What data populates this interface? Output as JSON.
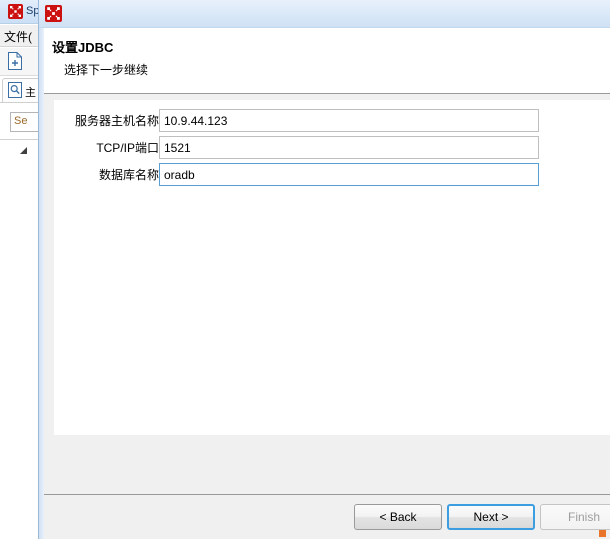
{
  "background_app": {
    "title": "Sp",
    "icon": "app-red-network-icon",
    "menu": {
      "file_label": "文件("
    },
    "toolbar": {
      "new_document_icon": "new-document-icon"
    },
    "tab": {
      "icon": "document-search-icon",
      "label": "主"
    },
    "search": {
      "value": "Se"
    },
    "tree": {
      "collapse_arrow_icon": "triangle-collapse-icon"
    }
  },
  "dialog": {
    "titlebar": {
      "icon": "dialog-red-network-icon",
      "title": ""
    },
    "header": {
      "title": "设置JDBC",
      "subtitle": "选择下一步继续"
    },
    "form": {
      "fields": [
        {
          "label": "服务器主机名称",
          "value": "10.9.44.123",
          "focused": false
        },
        {
          "label": "TCP/IP端口",
          "value": "1521",
          "focused": false
        },
        {
          "label": "数据库名称",
          "value": "oradb",
          "focused": true
        }
      ]
    },
    "buttons": {
      "back": {
        "label": "< Back",
        "disabled": false,
        "focused": false
      },
      "next": {
        "label": "Next >",
        "disabled": false,
        "focused": true
      },
      "finish": {
        "label": "Finish",
        "disabled": true,
        "focused": false
      }
    },
    "resize_grip": "resize-grip-icon"
  },
  "colors": {
    "accent_focus": "#3c9de0",
    "icon_red": "#cc1111",
    "grip_orange": "#e8752a",
    "dialog_bg": "#f0f0f0",
    "titlebar_blue": "#dbe9f8"
  }
}
